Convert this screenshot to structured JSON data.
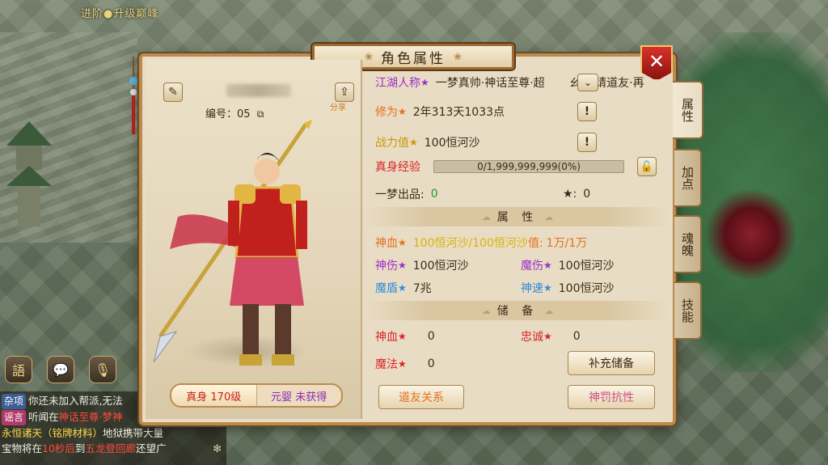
{
  "scene": {
    "top_banner": "进阶●升级巅峰"
  },
  "quick_icons": [
    {
      "name": "jade-chat-icon",
      "glyph": "語",
      "label": ""
    },
    {
      "name": "chat-bubble-icon",
      "glyph": "💬",
      "label": ""
    },
    {
      "name": "voice-icon",
      "glyph": "🎙",
      "label": ""
    }
  ],
  "chat": {
    "lines": [
      {
        "tag": "杂项",
        "tag_class": "tag-misc",
        "segments": [
          {
            "text": "你还未加入帮派,无法",
            "cls": ""
          }
        ]
      },
      {
        "tag": "谣言",
        "tag_class": "tag-rumor",
        "segments": [
          {
            "text": "听闻在",
            "cls": ""
          },
          {
            "text": "神话至尊·梦神",
            "cls": "hl-red"
          }
        ]
      },
      {
        "tag": "",
        "tag_class": "",
        "segments": [
          {
            "text": "永恒诸天（铭牌材料）",
            "cls": "hl-yellow"
          },
          {
            "text": "地狱携带大量",
            "cls": ""
          }
        ]
      },
      {
        "tag": "",
        "tag_class": "",
        "segments": [
          {
            "text": "宝物将在",
            "cls": ""
          },
          {
            "text": "10秒后",
            "cls": "hl-red"
          },
          {
            "text": "到",
            "cls": ""
          },
          {
            "text": "五龙登回廊",
            "cls": "hl-red"
          },
          {
            "text": "还望广",
            "cls": ""
          }
        ]
      }
    ]
  },
  "dialog": {
    "title": "角色属性",
    "close_label": "✕",
    "character": {
      "id_label": "编号：05",
      "share_label": "分享",
      "level_tabs": [
        {
          "label": "真身 170级",
          "active": true
        },
        {
          "label": "元婴 未获得",
          "active": false
        }
      ]
    },
    "info": {
      "title_label": "江湖人称",
      "title_value": "一梦真帅·神话至尊·超",
      "title_overflow": "ㄠ·邀请道友·再",
      "cultivation_label": "修为",
      "cultivation_value": "2年313天1033点",
      "power_label": "战力值",
      "power_value": "100恒河沙",
      "exp_label": "真身经验",
      "exp_text": "0/1,999,999,999(0%)",
      "exp_fraction": 0,
      "product_label": "一梦出品:",
      "product_value": "0",
      "star_label": "★:",
      "star_value": "0"
    },
    "attributes": {
      "section_title": "属 性",
      "shenxue_label": "神血",
      "shenxue_value": "100恒河沙/100恒河沙",
      "shenxue_extra_label": "值:",
      "shenxue_extra_value": "1万/1万",
      "shenshang_label": "神伤",
      "shenshang_value": "100恒河沙",
      "moshang_label": "魔伤",
      "moshang_value": "100恒河沙",
      "modun_label": "魔盾",
      "modun_value": "7兆",
      "shensu_label": "神速",
      "shensu_value": "100恒河沙"
    },
    "reserve": {
      "section_title": "储 备",
      "shenxue_label": "神血",
      "shenxue_value": "0",
      "loyalty_label": "忠诚",
      "loyalty_value": "0",
      "magic_label": "魔法",
      "magic_value": "0",
      "refill_button": "补充储备",
      "friends_button": "道友关系",
      "penalty_button": "神罚抗性"
    }
  },
  "side_tabs": [
    {
      "label": "属性",
      "active": true
    },
    {
      "label": "加点",
      "active": false
    },
    {
      "label": "魂魄",
      "active": false
    },
    {
      "label": "技能",
      "active": false
    }
  ],
  "colors": {
    "accent_gold": "#b98b4c",
    "close_red": "#d8322a",
    "label_purple": "#9b2fc9",
    "label_orange": "#e2701d",
    "label_red": "#d8252a",
    "label_blue": "#2e8cd8"
  }
}
